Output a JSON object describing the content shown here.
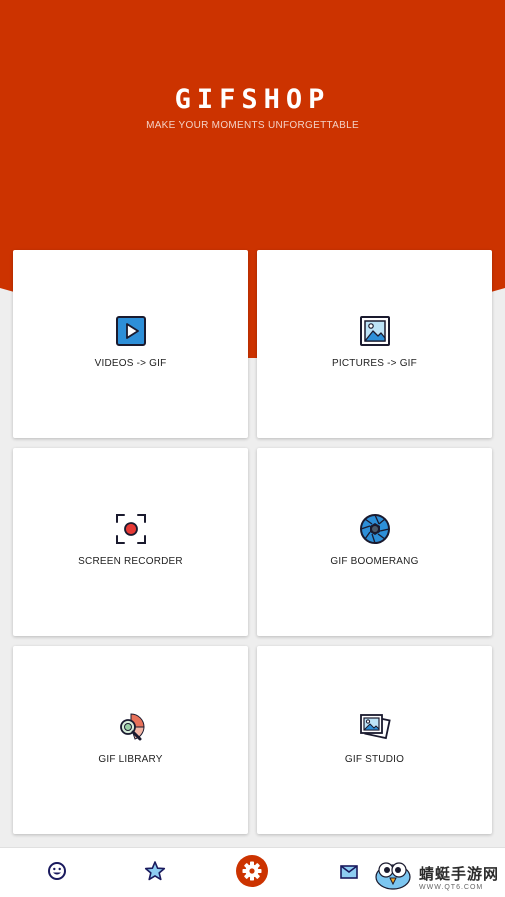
{
  "colors": {
    "brand": "#cc3300",
    "icon_blue": "#2d8fd8",
    "icon_dark": "#1a1a2e"
  },
  "header": {
    "title": "GIFSHOP",
    "subtitle": "MAKE YOUR MOMENTS UNFORGETTABLE"
  },
  "cards": [
    {
      "label": "VIDEOS -> GIF",
      "icon": "video-play-icon"
    },
    {
      "label": "PICTURES -> GIF",
      "icon": "picture-icon"
    },
    {
      "label": "SCREEN RECORDER",
      "icon": "screen-record-icon"
    },
    {
      "label": "GIF BOOMERANG",
      "icon": "camera-aperture-icon"
    },
    {
      "label": "GIF LIBRARY",
      "icon": "library-search-icon"
    },
    {
      "label": "GIF STUDIO",
      "icon": "photo-stack-icon"
    }
  ],
  "bottom_nav": [
    {
      "icon": "smiley-icon"
    },
    {
      "icon": "star-icon"
    },
    {
      "icon": "gear-icon"
    },
    {
      "icon": "mail-icon"
    }
  ],
  "watermark": {
    "text": "蜻蜓手游网",
    "url_text": "WWW.QT6.COM"
  }
}
